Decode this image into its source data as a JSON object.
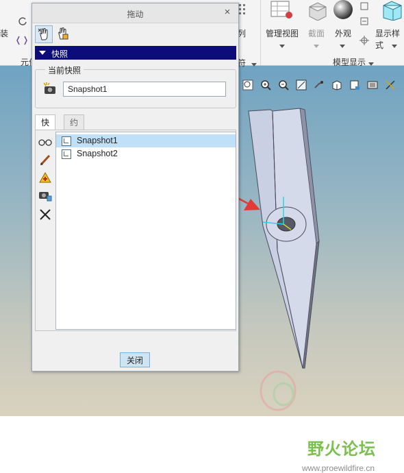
{
  "ribbon": {
    "left_partial_labels": [
      "装",
      "元件"
    ],
    "partial_labels": [
      "列",
      "符"
    ],
    "manage_view": "管理视图",
    "section": "截面",
    "appearance": "外观",
    "display_style": "显示样式",
    "model_display_group": "模型显示"
  },
  "dialog": {
    "title": "拖动",
    "close_glyph": "×",
    "section_label": "快照",
    "current_snapshot_label": "当前快照",
    "current_snapshot_value": "Snapshot1",
    "tabs": [
      {
        "label": "快照",
        "active": true
      },
      {
        "label": "约束",
        "active": false
      }
    ],
    "snapshots": [
      {
        "label": "Snapshot1",
        "selected": true
      },
      {
        "label": "Snapshot2",
        "selected": false
      }
    ],
    "close_button": "关闭"
  },
  "watermark": {
    "text": "野火论坛",
    "url": "www.proewildfire.cn"
  },
  "colors": {
    "section_bar": "#0c0c7a",
    "selection": "#bfe0f6",
    "arrow": "#e53935",
    "watermark": "#7bbf4e"
  }
}
